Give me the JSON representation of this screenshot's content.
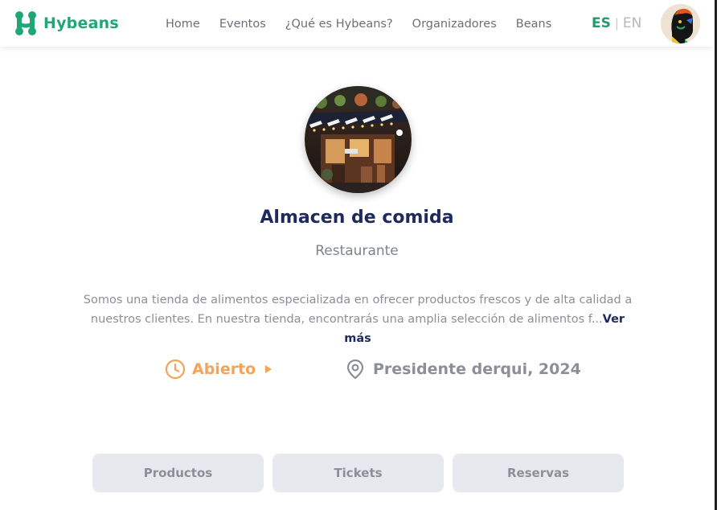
{
  "header": {
    "brand": "Hybeans",
    "brand_color": "#1fa876",
    "nav": [
      {
        "label": "Home"
      },
      {
        "label": "Eventos"
      },
      {
        "label": "¿Qué es Hybeans?"
      },
      {
        "label": "Organizadores"
      },
      {
        "label": "Beans"
      }
    ],
    "lang_active": "ES",
    "lang_separator": "|",
    "lang_inactive": "EN"
  },
  "profile": {
    "name": "Almacen de comida",
    "category": "Restaurante",
    "description": "Somos una tienda de alimentos especializada en ofrecer productos frescos y de alta calidad a nuestros clientes. En nuestra tienda, encontrarás una amplia selección de alimentos f...",
    "more_label": "Ver más",
    "status": "Abierto",
    "status_color": "#f3a35a",
    "address": "Presidente derqui, 2024"
  },
  "tabs": [
    {
      "label": "Productos"
    },
    {
      "label": "Tickets"
    },
    {
      "label": "Reservas"
    }
  ],
  "icons": {
    "logo": "hybeans-logo-icon",
    "status": "clock-icon",
    "address": "map-pin-icon",
    "dropdown": "caret-right-icon"
  }
}
